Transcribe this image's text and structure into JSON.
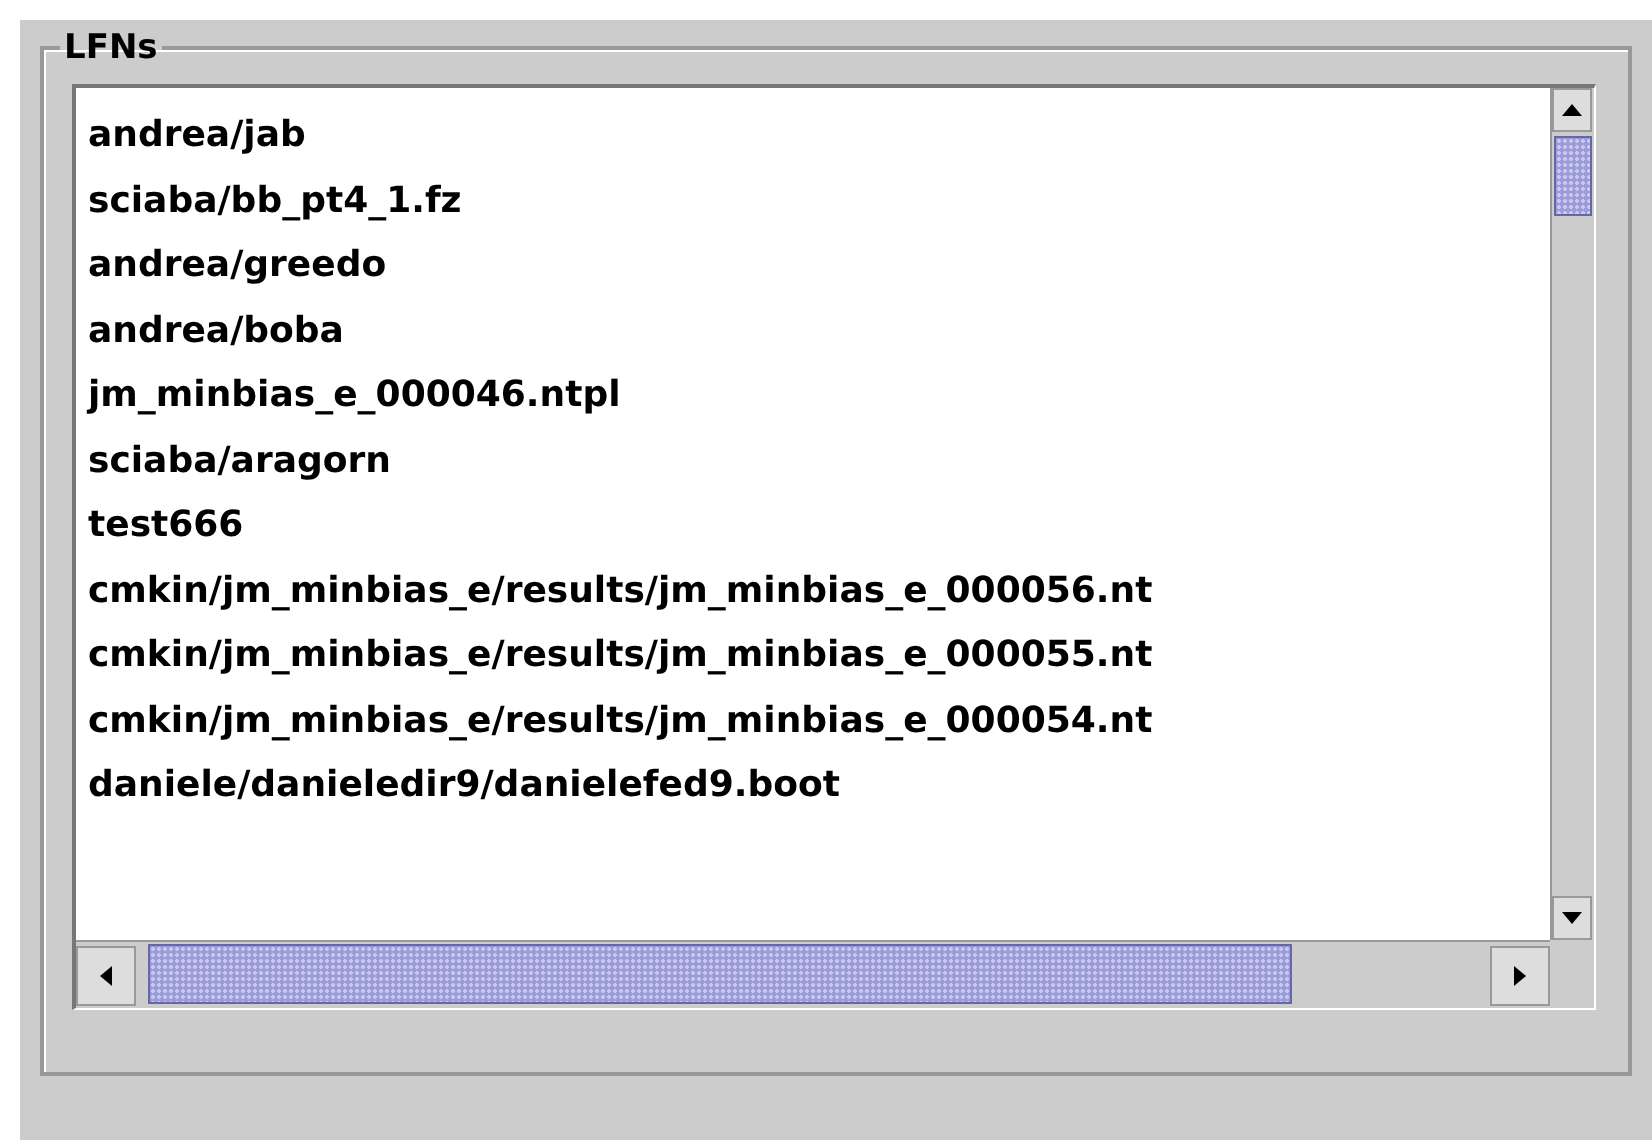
{
  "group": {
    "title": "LFNs"
  },
  "list": {
    "items": [
      {
        "text": "andrea/jab"
      },
      {
        "text": "sciaba/bb_pt4_1.fz"
      },
      {
        "text": "andrea/greedo"
      },
      {
        "text": "andrea/boba"
      },
      {
        "text": "jm_minbias_e_000046.ntpl"
      },
      {
        "text": "sciaba/aragorn"
      },
      {
        "text": "test666"
      },
      {
        "text": "cmkin/jm_minbias_e/results/jm_minbias_e_000056.nt"
      },
      {
        "text": "cmkin/jm_minbias_e/results/jm_minbias_e_000055.nt"
      },
      {
        "text": "cmkin/jm_minbias_e/results/jm_minbias_e_000054.nt"
      },
      {
        "text": "daniele/danieledir9/danielefed9.boot"
      }
    ]
  }
}
